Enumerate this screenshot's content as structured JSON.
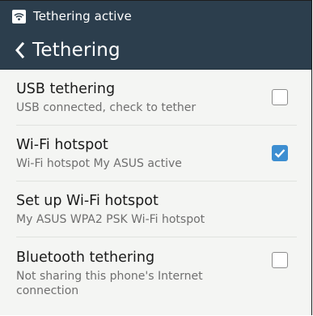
{
  "status_bar": {
    "text": "Tethering active",
    "icon": "wifi-hotspot-icon"
  },
  "action_bar": {
    "title": "Tethering",
    "back_icon": "chevron-left-icon"
  },
  "colors": {
    "header": "#2c3e4d",
    "accent": "#3d8ed1",
    "background": "#f4f5f3"
  },
  "items": [
    {
      "title": "USB tethering",
      "subtitle": "USB connected, check to tether",
      "checked": false
    },
    {
      "title": "Wi-Fi hotspot",
      "subtitle": "Wi-Fi hotspot My ASUS active",
      "checked": true
    },
    {
      "title": "Set up Wi-Fi hotspot",
      "subtitle": "My ASUS WPA2 PSK Wi-Fi hotspot"
    },
    {
      "title": "Bluetooth tethering",
      "subtitle_line1": "Not sharing this phone's Internet",
      "subtitle_line2": "connection",
      "checked": false
    }
  ]
}
